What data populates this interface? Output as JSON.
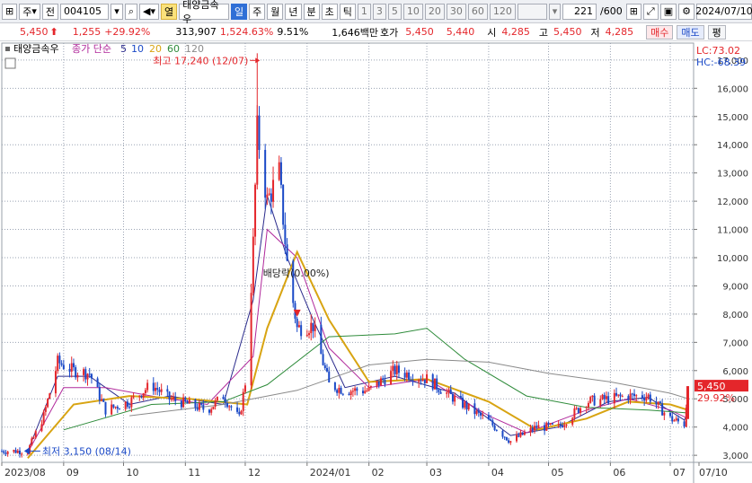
{
  "toolbar": {
    "market": "주",
    "type_sel": "전",
    "code": "004105",
    "tag": "열",
    "name": "태양금속우",
    "periods": [
      "일",
      "주",
      "월",
      "년",
      "분",
      "초",
      "틱"
    ],
    "active_period": "일",
    "minutes": [
      "1",
      "3",
      "5",
      "10",
      "20",
      "30",
      "60",
      "120"
    ],
    "count": "221",
    "count_total": "/600",
    "date": "2024/07/10"
  },
  "quote": {
    "price": "5,450",
    "change": "1,255",
    "change_pct": "+29.92%",
    "volume": "313,907",
    "volume_pct": "1,524.63%",
    "turnover": "9.51%",
    "value": "1,646백만",
    "bid_label": "호가",
    "bid_price": "5,450",
    "ask_price": "5,440",
    "open_label": "시",
    "open": "4,285",
    "high_label": "고",
    "high": "5,450",
    "low_label": "저",
    "low": "4,285",
    "buy_btn": "매수",
    "sell_btn": "매도",
    "eval_btn": "평"
  },
  "colors": {
    "up": "#e4262b",
    "down": "#1a49c7",
    "ma5": "#2b2b8c",
    "ma10": "#b0289b",
    "ma20": "#d8a412",
    "ma60": "#2e8b3a",
    "ma120": "#8a8a8a"
  },
  "chart_data": {
    "type": "candlestick",
    "legend": {
      "title": "태양금속우",
      "ma_label": "종가 단순",
      "ma_periods": [
        "5",
        "10",
        "20",
        "60",
        "120"
      ]
    },
    "ylim": [
      2750,
      17600
    ],
    "yticks": [
      3000,
      4000,
      5000,
      6000,
      7000,
      8000,
      9000,
      10000,
      11000,
      12000,
      13000,
      14000,
      15000,
      16000,
      17000
    ],
    "ytick_labels": [
      "3,000",
      "4,000",
      "5,000",
      "6,000",
      "7,000",
      "8,000",
      "9,000",
      "10,000",
      "11,000",
      "12,000",
      "13,000",
      "14,000",
      "15,000",
      "16,000",
      "17,000"
    ],
    "x_range": [
      "2023-08-01",
      "2024-07-10"
    ],
    "x_labels": [
      {
        "date": "2023-08-01",
        "label": "2023/08"
      },
      {
        "date": "2023-09-01",
        "label": "09"
      },
      {
        "date": "2023-10-01",
        "label": "10"
      },
      {
        "date": "2023-11-01",
        "label": "11"
      },
      {
        "date": "2023-12-01",
        "label": "12"
      },
      {
        "date": "2024-01-01",
        "label": "2024/01"
      },
      {
        "date": "2024-02-01",
        "label": "02"
      },
      {
        "date": "2024-03-01",
        "label": "03"
      },
      {
        "date": "2024-04-01",
        "label": "04"
      },
      {
        "date": "2024-05-01",
        "label": "05"
      },
      {
        "date": "2024-06-01",
        "label": "06"
      },
      {
        "date": "2024-07-01",
        "label": "07"
      },
      {
        "date": "2024-07-10",
        "label": "07/10"
      }
    ],
    "close_series": [
      {
        "date": "2023-08-01",
        "value": 3150
      },
      {
        "date": "2023-08-14",
        "value": 3150
      },
      {
        "date": "2023-08-22",
        "value": 4400
      },
      {
        "date": "2023-08-29",
        "value": 6300
      },
      {
        "date": "2023-09-06",
        "value": 6000
      },
      {
        "date": "2023-09-14",
        "value": 5900
      },
      {
        "date": "2023-09-22",
        "value": 4600
      },
      {
        "date": "2023-10-04",
        "value": 4900
      },
      {
        "date": "2023-10-15",
        "value": 5500
      },
      {
        "date": "2023-10-24",
        "value": 5000
      },
      {
        "date": "2023-11-03",
        "value": 4800
      },
      {
        "date": "2023-11-12",
        "value": 4600
      },
      {
        "date": "2023-11-20",
        "value": 5100
      },
      {
        "date": "2023-11-28",
        "value": 4300
      },
      {
        "date": "2023-12-02",
        "value": 6000
      },
      {
        "date": "2023-12-05",
        "value": 10500
      },
      {
        "date": "2023-12-07",
        "value": 14500
      },
      {
        "date": "2023-12-12",
        "value": 12000
      },
      {
        "date": "2023-12-18",
        "value": 13000
      },
      {
        "date": "2023-12-22",
        "value": 9800
      },
      {
        "date": "2023-12-27",
        "value": 7500
      },
      {
        "date": "2024-01-04",
        "value": 7600
      },
      {
        "date": "2024-01-12",
        "value": 5500
      },
      {
        "date": "2024-01-20",
        "value": 5300
      },
      {
        "date": "2024-02-01",
        "value": 5300
      },
      {
        "date": "2024-02-14",
        "value": 6000
      },
      {
        "date": "2024-03-01",
        "value": 5700
      },
      {
        "date": "2024-03-15",
        "value": 5000
      },
      {
        "date": "2024-04-01",
        "value": 4200
      },
      {
        "date": "2024-04-12",
        "value": 3500
      },
      {
        "date": "2024-04-25",
        "value": 4000
      },
      {
        "date": "2024-05-06",
        "value": 4000
      },
      {
        "date": "2024-05-20",
        "value": 4900
      },
      {
        "date": "2024-05-31",
        "value": 5000
      },
      {
        "date": "2024-06-10",
        "value": 5100
      },
      {
        "date": "2024-06-20",
        "value": 5100
      },
      {
        "date": "2024-07-01",
        "value": 4300
      },
      {
        "date": "2024-07-08",
        "value": 4100
      },
      {
        "date": "2024-07-10",
        "value": 5450
      }
    ],
    "ma_series": [
      {
        "name": "5",
        "values": [
          {
            "date": "2023-08-14",
            "value": 3150
          },
          {
            "date": "2023-08-29",
            "value": 5800
          },
          {
            "date": "2023-09-14",
            "value": 5800
          },
          {
            "date": "2023-10-04",
            "value": 4800
          },
          {
            "date": "2023-10-24",
            "value": 5100
          },
          {
            "date": "2023-11-20",
            "value": 4800
          },
          {
            "date": "2023-12-05",
            "value": 8500
          },
          {
            "date": "2023-12-12",
            "value": 12200
          },
          {
            "date": "2023-12-22",
            "value": 10000
          },
          {
            "date": "2024-01-04",
            "value": 7800
          },
          {
            "date": "2024-01-20",
            "value": 5400
          },
          {
            "date": "2024-02-14",
            "value": 5800
          },
          {
            "date": "2024-03-15",
            "value": 5200
          },
          {
            "date": "2024-04-12",
            "value": 3700
          },
          {
            "date": "2024-05-06",
            "value": 4000
          },
          {
            "date": "2024-05-31",
            "value": 4900
          },
          {
            "date": "2024-06-20",
            "value": 5050
          },
          {
            "date": "2024-07-08",
            "value": 4250
          },
          {
            "date": "2024-07-10",
            "value": 4500
          }
        ]
      },
      {
        "name": "10",
        "values": [
          {
            "date": "2023-08-14",
            "value": 3100
          },
          {
            "date": "2023-09-01",
            "value": 5400
          },
          {
            "date": "2023-09-22",
            "value": 5400
          },
          {
            "date": "2023-10-15",
            "value": 5100
          },
          {
            "date": "2023-11-12",
            "value": 4800
          },
          {
            "date": "2023-12-05",
            "value": 6500
          },
          {
            "date": "2023-12-12",
            "value": 11000
          },
          {
            "date": "2023-12-27",
            "value": 10000
          },
          {
            "date": "2024-01-12",
            "value": 6800
          },
          {
            "date": "2024-02-01",
            "value": 5400
          },
          {
            "date": "2024-03-01",
            "value": 5700
          },
          {
            "date": "2024-04-01",
            "value": 4400
          },
          {
            "date": "2024-04-20",
            "value": 3800
          },
          {
            "date": "2024-05-20",
            "value": 4600
          },
          {
            "date": "2024-06-10",
            "value": 5000
          },
          {
            "date": "2024-07-01",
            "value": 4600
          },
          {
            "date": "2024-07-10",
            "value": 4300
          }
        ]
      },
      {
        "name": "20",
        "values": [
          {
            "date": "2023-08-14",
            "value": 2900
          },
          {
            "date": "2023-09-06",
            "value": 4800
          },
          {
            "date": "2023-10-04",
            "value": 5100
          },
          {
            "date": "2023-11-03",
            "value": 5000
          },
          {
            "date": "2023-12-02",
            "value": 4800
          },
          {
            "date": "2023-12-12",
            "value": 7500
          },
          {
            "date": "2023-12-27",
            "value": 10200
          },
          {
            "date": "2024-01-12",
            "value": 7800
          },
          {
            "date": "2024-02-01",
            "value": 5600
          },
          {
            "date": "2024-03-01",
            "value": 5700
          },
          {
            "date": "2024-04-01",
            "value": 4900
          },
          {
            "date": "2024-04-25",
            "value": 3900
          },
          {
            "date": "2024-05-20",
            "value": 4300
          },
          {
            "date": "2024-06-10",
            "value": 4900
          },
          {
            "date": "2024-07-01",
            "value": 4800
          },
          {
            "date": "2024-07-10",
            "value": 4600
          }
        ]
      },
      {
        "name": "60",
        "values": [
          {
            "date": "2023-09-01",
            "value": 3900
          },
          {
            "date": "2023-10-15",
            "value": 4800
          },
          {
            "date": "2023-11-20",
            "value": 4900
          },
          {
            "date": "2023-12-12",
            "value": 5500
          },
          {
            "date": "2024-01-12",
            "value": 7200
          },
          {
            "date": "2024-02-14",
            "value": 7300
          },
          {
            "date": "2024-03-01",
            "value": 7500
          },
          {
            "date": "2024-03-20",
            "value": 6400
          },
          {
            "date": "2024-04-20",
            "value": 5100
          },
          {
            "date": "2024-05-20",
            "value": 4700
          },
          {
            "date": "2024-06-20",
            "value": 4600
          },
          {
            "date": "2024-07-10",
            "value": 4500
          }
        ]
      },
      {
        "name": "120",
        "values": [
          {
            "date": "2023-10-04",
            "value": 4400
          },
          {
            "date": "2023-11-20",
            "value": 4800
          },
          {
            "date": "2023-12-27",
            "value": 5300
          },
          {
            "date": "2024-02-01",
            "value": 6200
          },
          {
            "date": "2024-03-01",
            "value": 6400
          },
          {
            "date": "2024-04-01",
            "value": 6300
          },
          {
            "date": "2024-05-01",
            "value": 5900
          },
          {
            "date": "2024-06-01",
            "value": 5600
          },
          {
            "date": "2024-07-01",
            "value": 5200
          },
          {
            "date": "2024-07-10",
            "value": 5000
          }
        ]
      }
    ],
    "annotations": {
      "high": {
        "date": "2023-12-07",
        "value": 17240,
        "label": "최고 17,240 (12/07)"
      },
      "low": {
        "date": "2023-08-14",
        "value": 3150,
        "label": "최저 3,150 (08/14)"
      },
      "dividend": {
        "date": "2023-12-27",
        "value": 8000,
        "label": "배당락(0.00%)"
      }
    },
    "side_labels": {
      "lc": "LC:73.02",
      "hc": "HC:-68.39",
      "price": "5,450",
      "pct": "29.92%"
    }
  }
}
